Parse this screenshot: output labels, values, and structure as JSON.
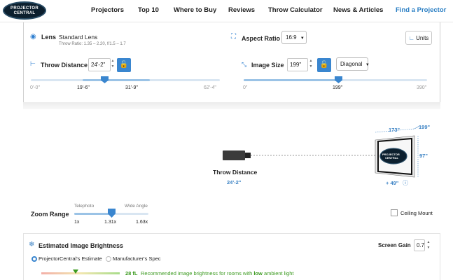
{
  "nav": {
    "logo_line1": "PROJECTOR",
    "logo_line2": "CENTRAL",
    "links": [
      "Projectors",
      "Top 10",
      "Where to Buy",
      "Reviews",
      "Throw Calculator",
      "News & Articles"
    ],
    "cta": "Find a Projector"
  },
  "lens": {
    "label": "Lens",
    "value": "Standard Lens",
    "spec": "Throw Ratio: 1.35 – 2.20, f/1.5 – 1.7"
  },
  "aspect": {
    "label": "Aspect Ratio",
    "value": "16:9"
  },
  "units_label": "Units",
  "throw": {
    "label": "Throw Distance",
    "value": "24'-2\"",
    "slider_min": "0'-0\"",
    "range_min": "19'-6\"",
    "range_max": "31'-9\"",
    "slider_max": "62'-4\"",
    "position": 0.39
  },
  "image_size": {
    "label": "Image Size",
    "value": "199\"",
    "mode": "Diagonal",
    "slider_min": "0\"",
    "current": "199\"",
    "slider_max": "390\"",
    "position": 0.51
  },
  "diagram": {
    "throw_label": "Throw Distance",
    "throw_value": "24'-2\"",
    "width": "173\"",
    "diagonal": "199\"",
    "height": "97\"",
    "offset": "+ 49\"",
    "screen_line1": "PROJECTOR",
    "screen_line2": "CENTRAL"
  },
  "zoom": {
    "label": "Zoom Range",
    "tele_label": "Telephoto",
    "wide_label": "Wide Angle",
    "min": "1x",
    "current": "1.31x",
    "max": "1.63x",
    "position": 0.5
  },
  "ceiling_mount": "Ceiling Mount",
  "brightness": {
    "title": "Estimated Image Brightness",
    "screen_gain_label": "Screen Gain",
    "screen_gain": "0.7",
    "option_estimate": "ProjectorCentral's Estimate",
    "option_spec": "Manufacturer's Spec",
    "value": "28 fL",
    "message_pre": "Recommended image brightness for rooms with",
    "message_bold": "low",
    "message_post": "ambient light"
  },
  "colors": {
    "accent": "#3a86cf",
    "link": "#2b7fc4",
    "good": "#3b9a1f"
  }
}
